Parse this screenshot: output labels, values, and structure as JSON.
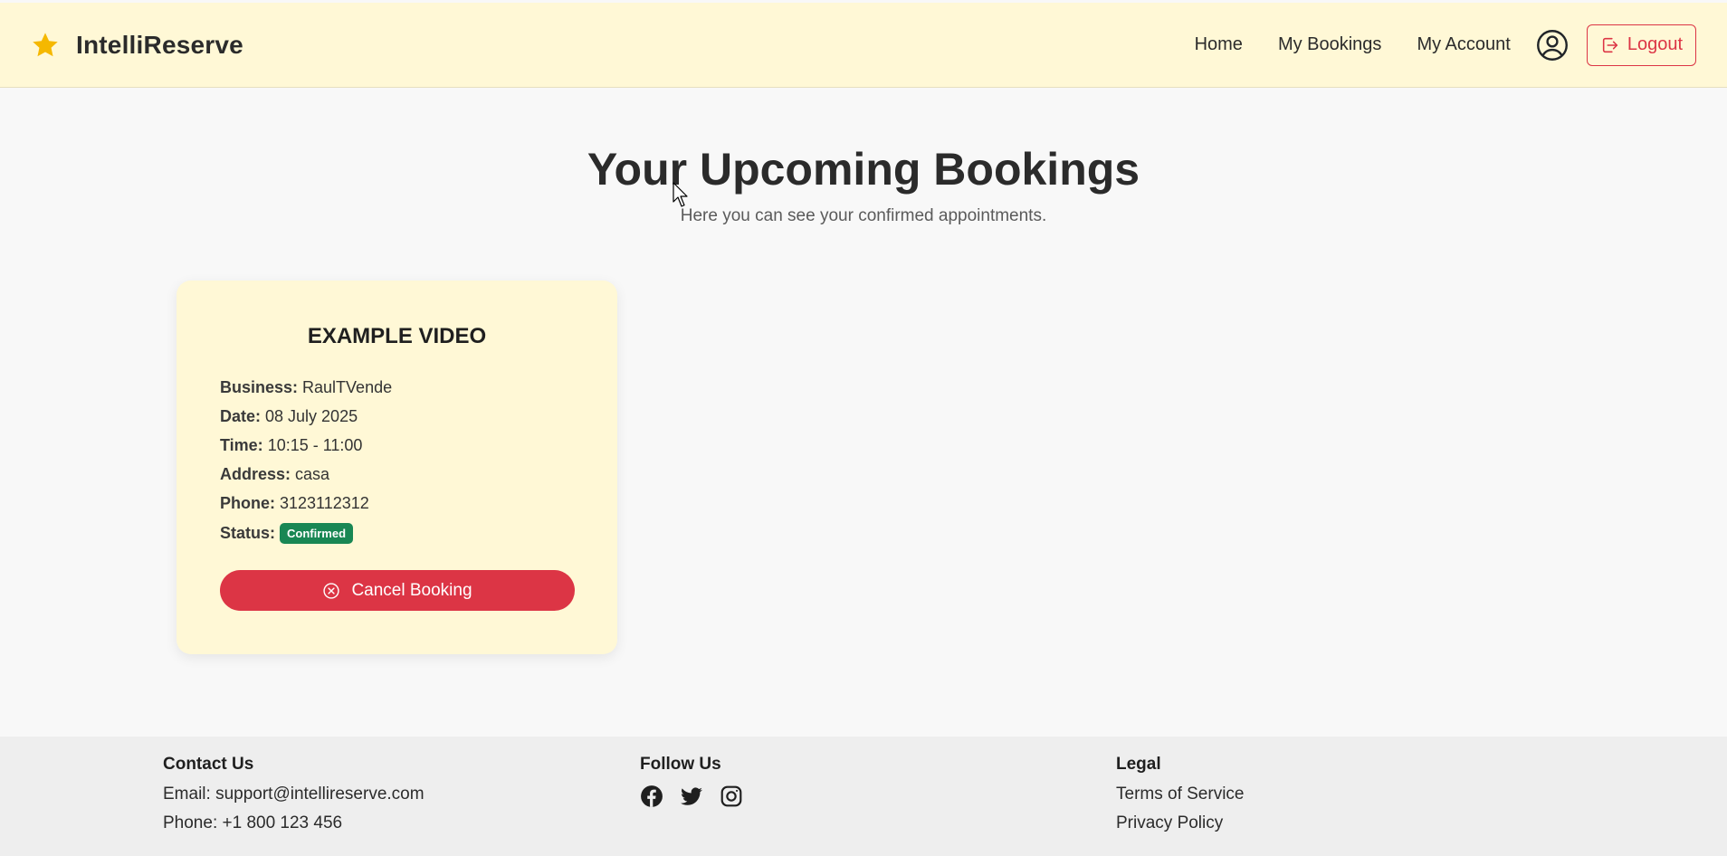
{
  "header": {
    "brand": "IntelliReserve",
    "nav": [
      "Home",
      "My Bookings",
      "My Account"
    ],
    "logout_label": "Logout"
  },
  "page": {
    "title": "Your Upcoming Bookings",
    "subtitle": "Here you can see your confirmed appointments."
  },
  "booking": {
    "title": "EXAMPLE VIDEO",
    "business_label": "Business:",
    "business": "RaulTVende",
    "date_label": "Date:",
    "date": "08 July 2025",
    "time_label": "Time:",
    "time": "10:15 - 11:00",
    "address_label": "Address:",
    "address": "casa",
    "phone_label": "Phone:",
    "phone": "3123112312",
    "status_label": "Status:",
    "status": "Confirmed",
    "cancel_label": "Cancel Booking"
  },
  "footer": {
    "contact_heading": "Contact Us",
    "email_line": "Email: support@intellireserve.com",
    "phone_line": "Phone: +1 800 123 456",
    "follow_heading": "Follow Us",
    "social_icons": [
      "facebook-icon",
      "twitter-icon",
      "instagram-icon"
    ],
    "legal_heading": "Legal",
    "terms": "Terms of Service",
    "privacy": "Privacy Policy"
  },
  "colors": {
    "header_bg": "#fff8d6",
    "accent_star": "#f5b800",
    "danger": "#dc3545",
    "success": "#198754"
  }
}
